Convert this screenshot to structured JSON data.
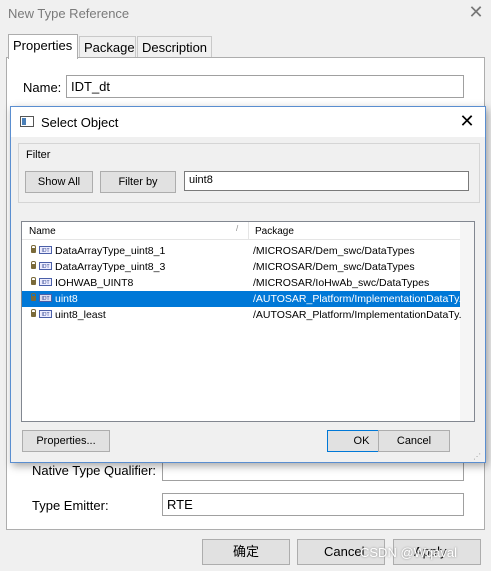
{
  "parent": {
    "title": "New Type Reference",
    "tabs": [
      "Properties",
      "Package",
      "Description"
    ],
    "name_label": "Name:",
    "name_value": "IDT_dt",
    "native_type_qualifier_label": "Native Type Qualifier:",
    "native_type_qualifier_value": "",
    "type_emitter_label": "Type Emitter:",
    "type_emitter_value": "RTE",
    "confirm_label": "确定",
    "cancel_label": "Cancel",
    "apply_label": "Apply",
    "watermark": "CSDN @Wqaval"
  },
  "modal": {
    "title": "Select Object",
    "filter_legend": "Filter",
    "show_all_label": "Show All",
    "filter_by_label": "Filter by",
    "filter_value": "uint8",
    "columns": {
      "name": "Name",
      "package": "Package"
    },
    "rows": [
      {
        "name": "DataArrayType_uint8_1",
        "package": "/MICROSAR/Dem_swc/DataTypes",
        "selected": false
      },
      {
        "name": "DataArrayType_uint8_3",
        "package": "/MICROSAR/Dem_swc/DataTypes",
        "selected": false
      },
      {
        "name": "IOHWAB_UINT8",
        "package": "/MICROSAR/IoHwAb_swc/DataTypes",
        "selected": false
      },
      {
        "name": "uint8",
        "package": "/AUTOSAR_Platform/ImplementationDataTy...",
        "selected": true
      },
      {
        "name": "uint8_least",
        "package": "/AUTOSAR_Platform/ImplementationDataTy...",
        "selected": false
      }
    ],
    "type_icon_text": "IDT",
    "properties_label": "Properties...",
    "ok_label": "OK",
    "cancel_label": "Cancel"
  },
  "colors": {
    "selection": "#0078d7",
    "dialog_bg": "#f0f0f0"
  }
}
